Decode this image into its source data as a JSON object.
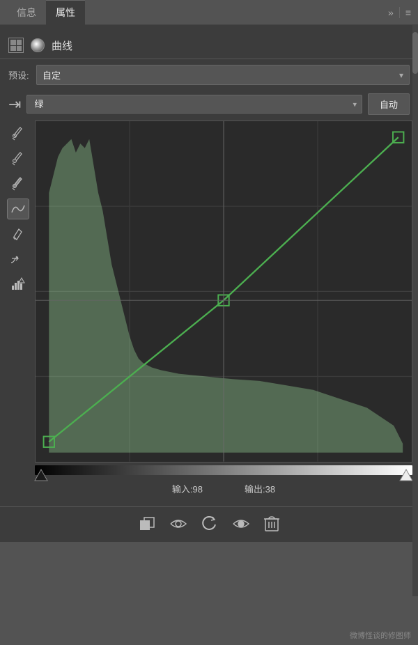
{
  "tabs": {
    "info": "信息",
    "properties": "属性"
  },
  "header": {
    "expand_icon": "»",
    "menu_icon": "≡"
  },
  "curve_section": {
    "title": "曲线"
  },
  "preset": {
    "label": "预设:",
    "value": "自定",
    "arrow": "▾"
  },
  "channel": {
    "value": "绿",
    "arrow": "▾",
    "auto_btn": "自动",
    "tool_arrow": "⇥"
  },
  "tools": [
    {
      "name": "eyedropper-white",
      "icon": "✦",
      "active": false
    },
    {
      "name": "eyedropper-mid",
      "icon": "✦",
      "active": false
    },
    {
      "name": "eyedropper-black",
      "icon": "✦",
      "active": false
    },
    {
      "name": "curve-tool",
      "icon": "∿",
      "active": true
    },
    {
      "name": "pencil-tool",
      "icon": "✏",
      "active": false
    },
    {
      "name": "smooth-tool",
      "icon": "⇥",
      "active": false
    },
    {
      "name": "histogram-warning",
      "icon": "⚠",
      "active": false
    }
  ],
  "input_output": {
    "input_label": "输入:",
    "input_value": "98",
    "output_label": "输出:",
    "output_value": "38"
  },
  "bottom_actions": [
    {
      "name": "clip-layer",
      "icon": "▣"
    },
    {
      "name": "visibility",
      "icon": "◉"
    },
    {
      "name": "reset",
      "icon": "↺"
    },
    {
      "name": "eye",
      "icon": "◉"
    },
    {
      "name": "delete",
      "icon": "🗑"
    }
  ],
  "watermark": "微博怪谈的修图师",
  "colors": {
    "bg": "#535353",
    "panel": "#3c3c3c",
    "curve_bg": "#2a2a2a",
    "grid": "#3a3a3a",
    "curve_color": "#4caf50",
    "histogram_fill": "rgba(180,255,180,0.35)"
  }
}
